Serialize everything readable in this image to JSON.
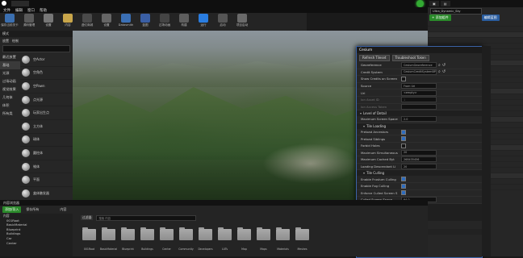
{
  "window": {
    "title": "UE4_Community2",
    "tab_doc": "DOC"
  },
  "menu": [
    "文件",
    "编辑",
    "窗口",
    "帮助"
  ],
  "toolbar": [
    {
      "label": "保存当前关卡",
      "color": "#3b6fb0"
    },
    {
      "label": "源码管理",
      "color": "#5a5a5a"
    },
    {
      "label": "设置",
      "color": "#777777"
    },
    {
      "label": "内容",
      "color": "#c9a64a"
    },
    {
      "label": "虚幻商城",
      "color": "#4a4a4a"
    },
    {
      "label": "设置",
      "color": "#666666"
    },
    {
      "label": "Datasmith",
      "color": "#3a6fb5"
    },
    {
      "label": "蓝图",
      "color": "#3a5fa5"
    },
    {
      "label": "过场动画",
      "color": "#444444"
    },
    {
      "label": "构建",
      "color": "#5e5e5e"
    },
    {
      "label": "运行",
      "color": "#2a7de0"
    },
    {
      "label": "启动",
      "color": "#555555"
    },
    {
      "label": "项目启动",
      "color": "#6a6a6a"
    }
  ],
  "place_panel": {
    "tab": "模式",
    "tools": [
      "放置",
      "绘制"
    ],
    "categories": [
      "最近放置",
      "基础",
      "光源",
      "过场动画",
      "视觉效果",
      "几何体",
      "体积",
      "所有类"
    ],
    "items": [
      "空Actor",
      "空角色",
      "空Pawn",
      "点光源",
      "玩家出生点",
      "立方体",
      "球体",
      "圆柱体",
      "锥体",
      "平面",
      "盒体触发器",
      "球体触发器"
    ]
  },
  "outliner": {
    "search_value": "Ultra_Dynamic_Sky",
    "add_button": "+ 添加组件",
    "blueprint_button": "编辑蓝图"
  },
  "cesium": {
    "title": "Cesium",
    "buttons": [
      "Refresh Tileset",
      "Troubleshoot Token"
    ],
    "props": [
      {
        "label": "Georeference",
        "value": "CesiumGeoreference",
        "enabled": true
      },
      {
        "label": "Credit System",
        "value": "CesiumCreditSystemBP",
        "enabled": true
      },
      {
        "label": "Show Credits on Screen",
        "checkbox": false,
        "enabled": true
      },
      {
        "label": "Source",
        "value": "From Url",
        "enabled": true
      },
      {
        "label": "Url",
        "value": "<empty>",
        "enabled": true
      },
      {
        "label": "Ion Asset ID",
        "value": "1",
        "enabled": false
      },
      {
        "label": "Ion Access Token",
        "value": "",
        "enabled": false
      }
    ],
    "sections": {
      "level_of_detail": "Level of Detail",
      "tile_loading": "Tile Loading",
      "tile_culling": "Tile Culling"
    },
    "lod": [
      {
        "label": "Maximum Screen Space",
        "value": "2.0"
      }
    ],
    "loading": [
      {
        "label": "Preload Ancestors",
        "checkbox": true
      },
      {
        "label": "Preload Siblings",
        "checkbox": true
      },
      {
        "label": "Forbid Holes",
        "checkbox": false
      },
      {
        "label": "Maximum Simultaneous",
        "value": "20"
      },
      {
        "label": "Maximum Cached Byt",
        "value": "268435456"
      },
      {
        "label": "Loading Descendant Li",
        "value": "20"
      }
    ],
    "culling": [
      {
        "label": "Enable Frustum Culling",
        "checkbox": true
      },
      {
        "label": "Enable Fog Culling",
        "checkbox": true
      },
      {
        "label": "Enforce Culled Screen S",
        "checkbox": true
      },
      {
        "label": "Culled Screen Space",
        "value": "64.0"
      }
    ],
    "collapsed": [
      "Debug",
      "Physics",
      "Rendering"
    ],
    "footer": "Cesium Clipping"
  },
  "content_browser": {
    "tab": "内容浏览器",
    "add_button": "添加/导入",
    "save_button": "保存所有",
    "path": "内容",
    "filter_label": "过滤器",
    "search_placeholder": "搜索 内容",
    "tree": [
      "内容",
      "001Root",
      "BasicMaterial",
      "Blueprint",
      "Buildings",
      "Car",
      "Center"
    ],
    "folders": [
      "001Root",
      "BasicMaterial",
      "Blueprint",
      "Buildings",
      "Center",
      "Community",
      "Developers",
      "LUTs",
      "Map",
      "Maps",
      "Materials",
      "Meshes"
    ]
  }
}
